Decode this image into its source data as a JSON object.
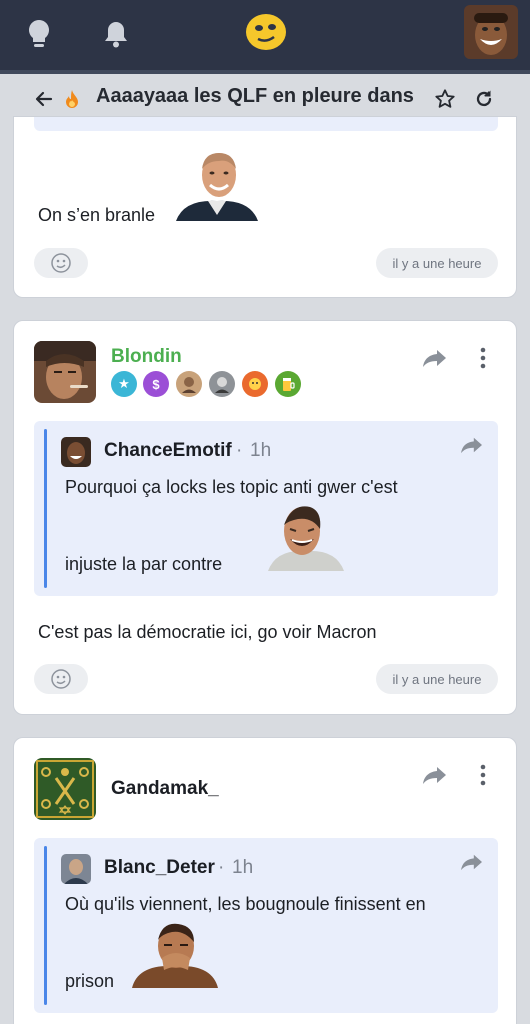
{
  "topbar": {
    "icons": [
      "lightbulb-icon",
      "bell-icon",
      "app-logo",
      "user-avatar"
    ],
    "colors": {
      "bg": "#2d3446",
      "logo": "#f5c72b"
    }
  },
  "subbar": {
    "title": "Aaaayaaa les QLF en pleure dans l",
    "icons": [
      "back-arrow-icon",
      "fire-icon",
      "star-icon",
      "refresh-icon"
    ]
  },
  "posts": [
    {
      "text": "On s’en branle",
      "sticker": "zidane-sticker",
      "time": "il y a une heure"
    },
    {
      "author": "Blondin",
      "author_color": "#4caf50",
      "badges": [
        "stars-badge",
        "dollar-badge",
        "avatar-badge",
        "avatar-badge",
        "fire-face-badge",
        "beer-badge"
      ],
      "quote": {
        "author": "ChanceEmotif",
        "sep": "·",
        "time": "1h",
        "line1": "Pourquoi ça locks les topic anti gwer c'est",
        "line2": "injuste la par contre",
        "sticker": "laughing-man-sticker"
      },
      "text": "C'est pas la démocratie ici, go voir Macron",
      "time": "il y a une heure"
    },
    {
      "author": "Gandamak_",
      "quote": {
        "author": "Blanc_Deter",
        "sep": "·",
        "time": "1h",
        "line1": "Où qu'ils viennent, les bougnoule finissent en",
        "line2": "prison",
        "sticker": "facepalm-sticker"
      }
    }
  ]
}
